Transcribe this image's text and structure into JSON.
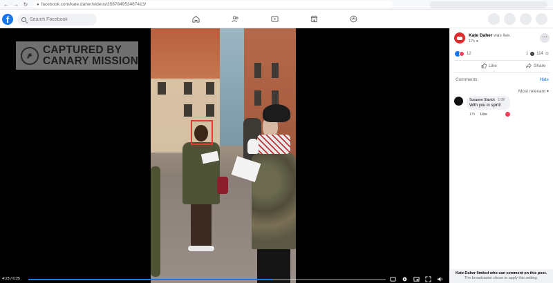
{
  "browser": {
    "url": "facebook.com/kate.daher/videos/358784953467413/"
  },
  "header": {
    "logo": "f",
    "search_placeholder": "Search Facebook",
    "nav": [
      "home-icon",
      "friends-icon",
      "watch-icon",
      "marketplace-icon",
      "groups-icon"
    ]
  },
  "video": {
    "watermark_line1": "CAPTURED BY",
    "watermark_line2": "CANARY MISSION",
    "time": "4:23 / 6:25",
    "progress": 0.683,
    "accent": "#1877f2"
  },
  "post": {
    "author": "Kate Daher",
    "status": "was live.",
    "time": "17h",
    "reaction_count": "12",
    "comment_count": "1",
    "view_count": "114",
    "like_label": "Like",
    "share_label": "Share"
  },
  "comments": {
    "header": "Comments",
    "hide_label": "Hide",
    "sort_label": "Most relevant",
    "items": [
      {
        "name": "Susanne Slavick",
        "time": "1:09",
        "text": "With you in spirit!",
        "age": "17h",
        "like": "Like"
      }
    ]
  },
  "footer": {
    "line1": "Kate Daher limited who can comment on this post.",
    "line2": "The broadcaster chose to apply this setting."
  }
}
